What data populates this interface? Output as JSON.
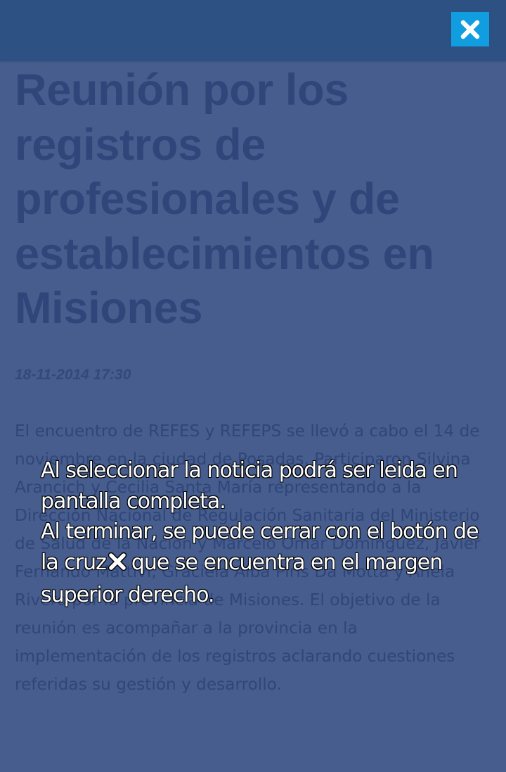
{
  "header": {
    "close_icon": "close-icon"
  },
  "article": {
    "title": "Reunión por los registros de profesionales y de establecimientos en Misiones",
    "date": "18-11-2014 17:30",
    "body": "El encuentro de REFES y REFEPS se llevó a cabo el 14 de noviembre en la ciudad de Posadas. Participaron Silvina Arancich y Cecilia Santa María representando a la Dirección Nacional de Regulación Sanitaria del Ministerio de Salud de la Nación y Marcelo Omar Domínguez, Javier Fernando Mattivi, Graciela Alba Piris Da Motta y Anela Rivero por la provincia de Misiones. El objetivo de la reunión es acompañar a la provincia en la implementación de los registros aclarando cuestiones referidas su gestión y desarrollo."
  },
  "tip": {
    "line1": "Al seleccionar la noticia podrá ser leida en pantalla completa.",
    "line2_before_icon": "Al terminar, se puede cerrar con el botón de la cruz",
    "line2_after_icon": "que se encuentra en el margen superior derecho.",
    "icon": "close-icon"
  },
  "colors": {
    "background": "#465d8e",
    "topbar": "#2e5183",
    "close_button": "#119ee0",
    "faded_text": "#30467a",
    "tip_text": "#ffffff"
  }
}
